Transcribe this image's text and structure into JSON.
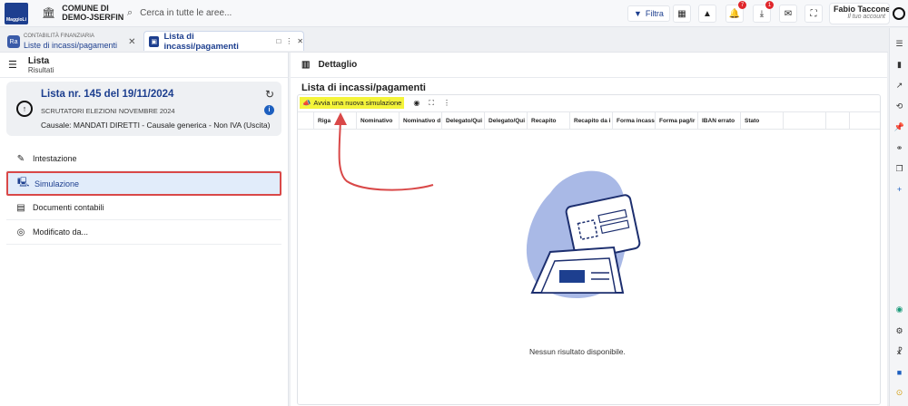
{
  "topbar": {
    "logo_text": "MaggioLi",
    "entity_line1": "COMUNE DI",
    "entity_line2": "DEMO-JSERFIN",
    "search_placeholder": "Cerca in tutte le aree...",
    "filter_label": "Filtra",
    "notif_badge": "7",
    "download_badge": "1",
    "user_name": "Fabio Tacconell...",
    "user_account": "Il tuo account"
  },
  "tabs": [
    {
      "small": "CONTABILITÀ FINANZIARIA",
      "label": "Liste di incassi/pagamenti",
      "icon": "Ra"
    },
    {
      "label": "Lista di incassi/pagamenti"
    }
  ],
  "left": {
    "header_title": "Lista",
    "header_sub": "Risultati",
    "card": {
      "title": "Lista nr. 145 del 19/11/2024",
      "subtitle": "SCRUTATORI ELEZIONI NOVEMBRE 2024",
      "causale": "Causale: MANDATI DIRETTI - Causale generica - Non IVA (Uscita)"
    },
    "menu": [
      {
        "label": "Intestazione",
        "icon": "pencil-icon"
      },
      {
        "label": "Simulazione",
        "icon": "simulation-icon",
        "selected": true
      },
      {
        "label": "Documenti contabili",
        "icon": "document-icon"
      },
      {
        "label": "Modificato da...",
        "icon": "fingerprint-icon"
      }
    ]
  },
  "main": {
    "header_title": "Dettaglio",
    "section_title": "Lista di incassi/pagamenti",
    "toolbar": {
      "start_simulation": "Avvia una nuova simulazione"
    },
    "columns": [
      "Riga",
      "Nominativo",
      "Nominativo d",
      "Delegato/Qui",
      "Delegato/Qui",
      "Recapito",
      "Recapito da i",
      "Forma incass",
      "Forma pag/ir",
      "IBAN errato",
      "Stato"
    ],
    "empty_message": "Nessun risultato disponibile."
  },
  "colors": {
    "brand": "#1d3f8f",
    "highlight": "#f4f43a",
    "annotation": "#d94848"
  }
}
